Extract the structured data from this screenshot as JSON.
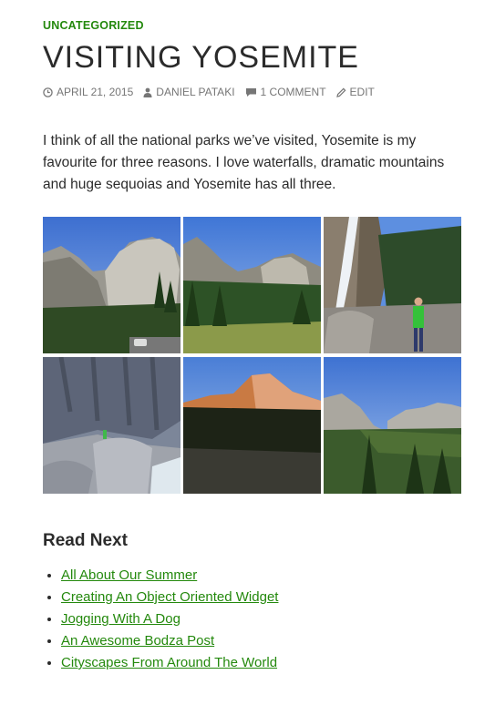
{
  "post": {
    "category": "UNCATEGORIZED",
    "title": "VISITING YOSEMITE",
    "meta": {
      "date": "APRIL 21, 2015",
      "author": "DANIEL PATAKI",
      "comments": "1 COMMENT",
      "edit": "EDIT"
    },
    "intro": "I think of all the national parks we’ve visited, Yosemite is my favourite for three reasons. I love waterfalls, dramatic mountains and huge sequoias and Yosemite has all three.",
    "gallery": [
      {
        "name": "el-capitan-photo"
      },
      {
        "name": "valley-meadow-photo"
      },
      {
        "name": "waterfall-hiker-photo"
      },
      {
        "name": "granite-rocks-photo"
      },
      {
        "name": "sunset-peak-photo"
      },
      {
        "name": "tunnel-view-photo"
      }
    ]
  },
  "read_next": {
    "heading": "Read Next",
    "items": [
      "All About Our Summer",
      "Creating An Object Oriented Widget",
      "Jogging With A Dog",
      "An Awesome Bodza Post",
      "Cityscapes From Around The World"
    ]
  },
  "colors": {
    "accent": "#24890d",
    "text": "#2b2b2b",
    "meta": "#767676"
  }
}
